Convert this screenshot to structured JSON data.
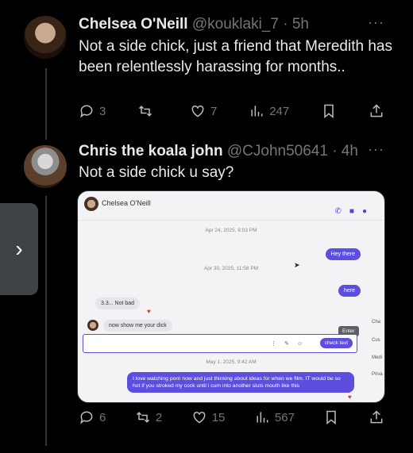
{
  "tweets": [
    {
      "name": "Chelsea O'Neill",
      "handle": "@kouklaki_7",
      "time": "· 5h",
      "text": "Not a side chick, just a friend that Meredith has been relentlessly harassing for months..",
      "counts": {
        "replies": "3",
        "retweets": "",
        "likes": "7",
        "views": "247"
      }
    },
    {
      "name": "Chris the koala john",
      "handle": "@CJohn50641",
      "time": "· 4h",
      "text": "Not a side chick u say?",
      "counts": {
        "replies": "6",
        "retweets": "2",
        "likes": "15",
        "views": "567"
      }
    }
  ],
  "more_label": "···",
  "side_tab_label": "›",
  "screenshot": {
    "contact_name": "Chelsea O'Neill",
    "date1": "Apr 24, 2025, 8:03 PM",
    "msg_hey": "Hey there",
    "date2": "Apr 30, 2025, 11:58 PM",
    "msg_here": "here",
    "msg_not_bad": "3.3... Not bad",
    "msg_show": "now show me your dick",
    "tooltip": "Enter",
    "send_label": "check text",
    "date3": "May 1, 2025, 9:42 AM",
    "msg_long": "I love watching porn now and just thinking about ideas for when we film. IT would be so hot if you stroked my cock until i cum into another sluts mouth like this",
    "side_labels": [
      "Cha",
      "Cus",
      "Medi",
      "Priva"
    ]
  }
}
